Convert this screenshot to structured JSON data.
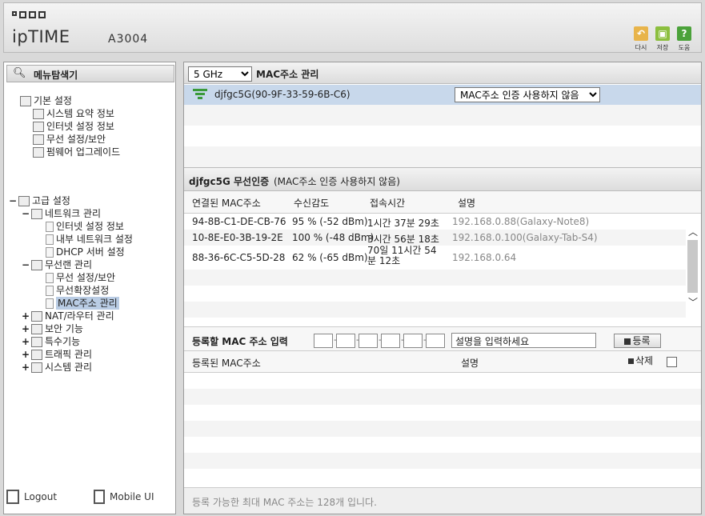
{
  "header": {
    "logo_brand": "ipTIME",
    "logo_model": "A3004",
    "buttons": [
      {
        "label": "다시",
        "icon": "undo-icon",
        "color": "#e8b44a"
      },
      {
        "label": "저장",
        "icon": "save-icon",
        "color": "#8cbf3f"
      },
      {
        "label": "도움",
        "icon": "help-icon",
        "color": "#4ba23a"
      }
    ]
  },
  "sidebar": {
    "search_label": "메뉴탐색기",
    "basic": {
      "label": "기본 설정",
      "items": [
        "시스템 요약 정보",
        "인터넷 설정 정보",
        "무선 설정/보안",
        "펌웨어 업그레이드"
      ]
    },
    "advanced": {
      "label": "고급 설정",
      "network": {
        "label": "네트워크 관리",
        "items": [
          "인터넷 설정 정보",
          "내부 네트워크 설정",
          "DHCP 서버 설정"
        ]
      },
      "wireless": {
        "label": "무선랜 관리",
        "items": [
          "무선 설정/보안",
          "무선확장설정",
          "MAC주소 관리"
        ]
      },
      "others": [
        "NAT/라우터 관리",
        "보안 기능",
        "특수기능",
        "트래픽 관리",
        "시스템 관리"
      ]
    },
    "footer": {
      "logout": "Logout",
      "mobile": "Mobile UI"
    }
  },
  "main": {
    "band_select": "5 GHz",
    "title": "MAC주소 관리",
    "ssid": "djfgc5G(90-9F-33-59-6B-C6)",
    "auth_mode": "MAC주소 인증 사용하지 않음",
    "section_title": "djfgc5G 무선인증",
    "section_subtitle": "(MAC주소 인증 사용하지 않음)",
    "connected_headers": {
      "mac": "연결된 MAC주소",
      "signal": "수신감도",
      "time": "접속시간",
      "desc": "설명"
    },
    "connected": [
      {
        "mac": "94-8B-C1-DE-CB-76",
        "signal": "95 % (-52 dBm)",
        "time": "1시간 37분 29초",
        "desc": "192.168.0.88(Galaxy-Note8)"
      },
      {
        "mac": "10-8E-E0-3B-19-2E",
        "signal": "100 % (-48 dBm)",
        "time": "3시간 56분 18초",
        "desc": "192.168.0.100(Galaxy-Tab-S4)"
      },
      {
        "mac": "88-36-6C-C5-5D-28",
        "signal": "62 % (-65 dBm)",
        "time": "70일 11시간 54분 12초",
        "desc": "192.168.0.64"
      }
    ],
    "register": {
      "label": "등록할 MAC 주소 입력",
      "desc_placeholder": "설명을 입력하세요",
      "button": "등록"
    },
    "registered_headers": {
      "mac": "등록된 MAC주소",
      "desc": "설명",
      "delete": "삭제"
    },
    "footer_note": "등록 가능한 최대 MAC 주소는 128개 입니다."
  }
}
